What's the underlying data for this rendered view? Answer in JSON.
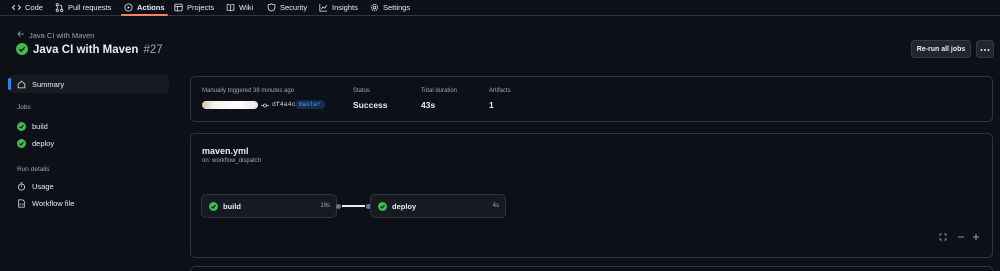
{
  "nav": {
    "items": [
      {
        "label": "Code",
        "icon": "code-icon"
      },
      {
        "label": "Pull requests",
        "icon": "pull-request-icon"
      },
      {
        "label": "Actions",
        "icon": "actions-play-icon",
        "active": true
      },
      {
        "label": "Projects",
        "icon": "table-icon"
      },
      {
        "label": "Wiki",
        "icon": "book-icon"
      },
      {
        "label": "Security",
        "icon": "shield-icon"
      },
      {
        "label": "Insights",
        "icon": "graph-icon"
      },
      {
        "label": "Settings",
        "icon": "gear-icon"
      }
    ]
  },
  "header": {
    "back_label": "Java CI with Maven",
    "run_title": "Java CI with Maven",
    "run_number": "#27",
    "rerun_label": "Re-run all jobs"
  },
  "sidebar": {
    "summary_label": "Summary",
    "jobs_heading": "Jobs",
    "jobs": [
      {
        "label": "build"
      },
      {
        "label": "deploy"
      }
    ],
    "run_details_heading": "Run details",
    "details": [
      {
        "label": "Usage"
      },
      {
        "label": "Workflow file"
      }
    ]
  },
  "summary": {
    "trigger_text": "Manually triggered 38 minutes ago",
    "commit_sha": "df4a4c8",
    "branch": "master",
    "status_label": "Status",
    "status_value": "Success",
    "duration_label": "Total duration",
    "duration_value": "43s",
    "artifacts_label": "Artifacts",
    "artifacts_value": "1"
  },
  "workflow": {
    "file_name": "maven.yml",
    "trigger": "on: workflow_dispatch",
    "jobs": [
      {
        "name": "build",
        "duration": "19s"
      },
      {
        "name": "deploy",
        "duration": "4s"
      }
    ]
  },
  "colors": {
    "success": "#3fb950",
    "accent_underline": "#f78166",
    "selected_bar": "#2f81f7"
  }
}
